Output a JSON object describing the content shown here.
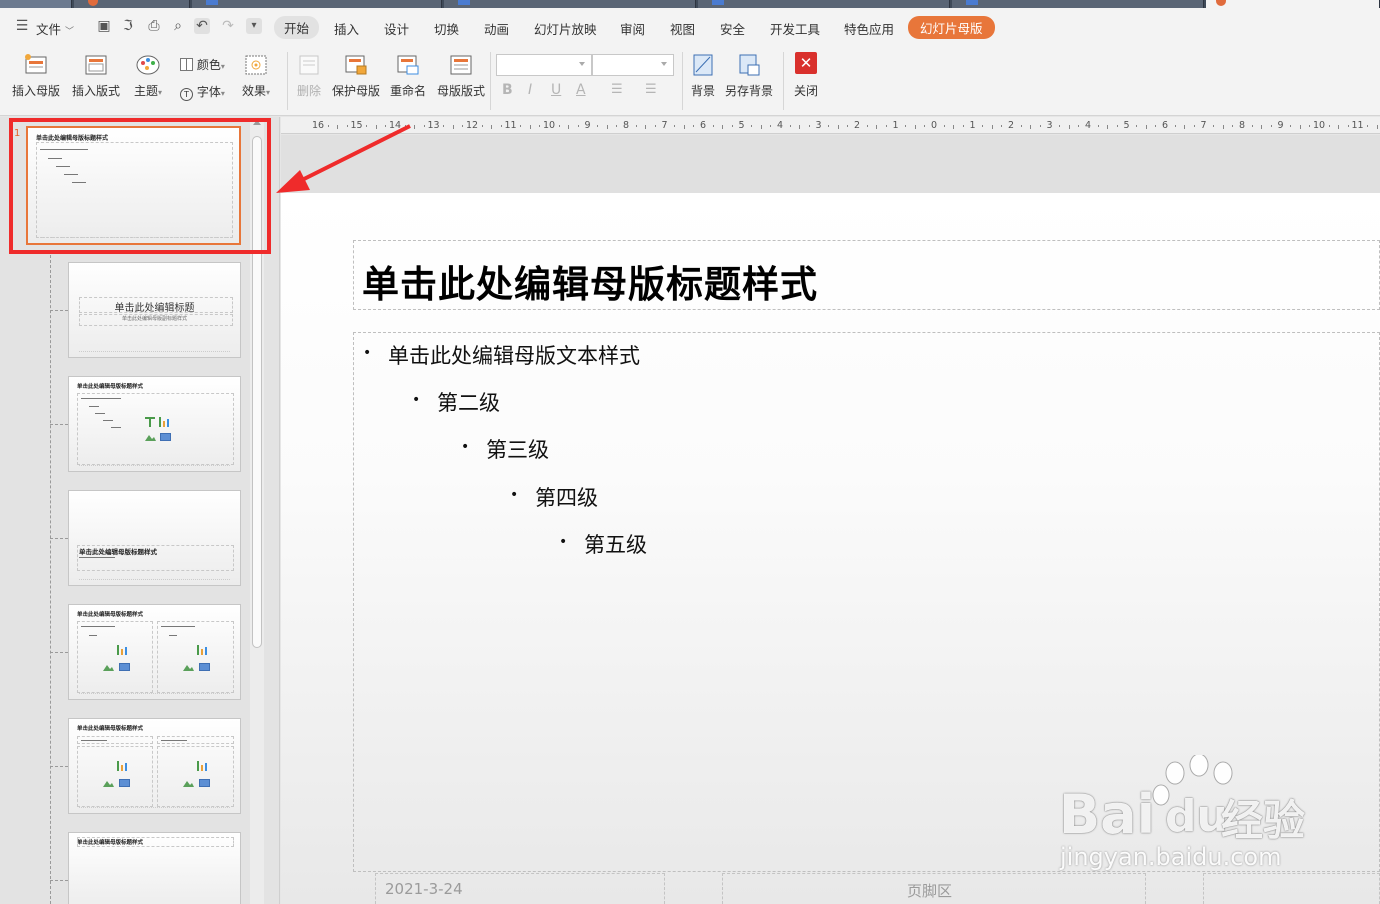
{
  "menubar": {
    "file_label": "文件",
    "tabs": [
      "开始",
      "插入",
      "设计",
      "切换",
      "动画",
      "幻灯片放映",
      "审阅",
      "视图",
      "安全",
      "开发工具",
      "特色应用",
      "幻灯片母版"
    ],
    "active_tab": "开始",
    "highlight_tab": "幻灯片母版",
    "highlight_color": "#e8763a"
  },
  "ribbon": {
    "insert_master": "插入母版",
    "insert_layout": "插入版式",
    "theme": "主题",
    "colors": "颜色",
    "font": "字体",
    "effects": "效果",
    "delete": "删除",
    "protect_master": "保护母版",
    "rename": "重命名",
    "master_layout": "母版版式",
    "format_buttons": [
      "B",
      "I",
      "U",
      "A"
    ],
    "background": "背景",
    "save_background": "另存背景",
    "close": "关闭"
  },
  "ruler": {
    "ticks": [
      "16",
      "15",
      "14",
      "13",
      "12",
      "11",
      "10",
      "9",
      "8",
      "7",
      "6",
      "5",
      "4",
      "3",
      "2",
      "1",
      "0",
      "1",
      "2",
      "3",
      "4",
      "5",
      "6",
      "7",
      "8",
      "9",
      "10",
      "11"
    ]
  },
  "thumbnails": {
    "first_number": "1",
    "master_title": "单击此处编辑母版标题样式",
    "master_text": "单击此处编辑母版文本样式",
    "levels_small": [
      "第二级",
      "第三级",
      "第四级",
      "第五级"
    ],
    "title_slide_title": "单击此处编辑标题",
    "title_slide_subtitle": "单击此处编辑母版副标题样式",
    "section_title": "单击此处编辑母版标题样式"
  },
  "slide": {
    "title": "单击此处编辑母版标题样式",
    "levels": [
      "单击此处编辑母版文本样式",
      "第二级",
      "第三级",
      "第四级",
      "第五级"
    ],
    "bullet": "•",
    "footer_date": "2021-3-24",
    "footer_center": "页脚区"
  },
  "watermark": {
    "brand_left": "Bai",
    "brand_mid": "du",
    "brand_right": "经验",
    "url": "jingyan.baidu.com"
  }
}
